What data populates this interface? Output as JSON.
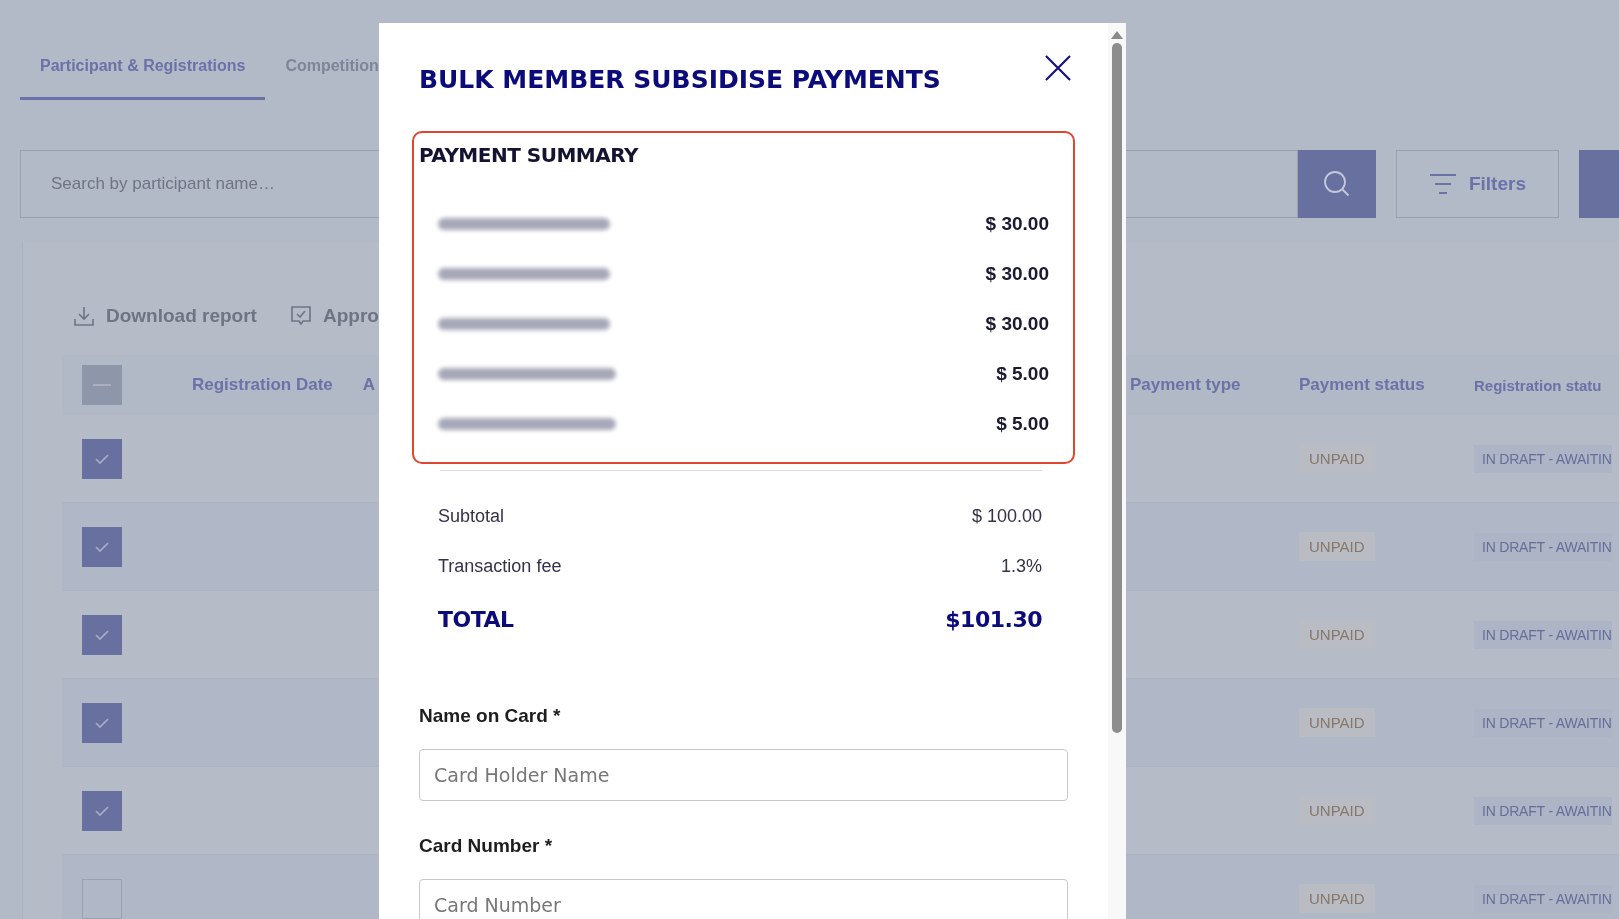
{
  "tabs": [
    {
      "label": "Participant & Registrations",
      "selected": true
    },
    {
      "label": "Competition",
      "selected": false
    }
  ],
  "search": {
    "placeholder": "Search by participant name…"
  },
  "filters_button": "Filters",
  "toolbar": [
    {
      "kind": "download",
      "label": "Download report"
    },
    {
      "kind": "approve",
      "label": "Appro"
    }
  ],
  "table": {
    "header_checkbox": {
      "indeterminate": true
    },
    "columns_left": [
      "Registration Date",
      "A"
    ],
    "columns_right": [
      "Payment type",
      "Payment status",
      "Registration statu"
    ],
    "rows": [
      {
        "checked": true,
        "payment_status": "UNPAID",
        "registration_status": "IN DRAFT - AWAITIN"
      },
      {
        "checked": true,
        "payment_status": "UNPAID",
        "registration_status": "IN DRAFT - AWAITIN"
      },
      {
        "checked": true,
        "payment_status": "UNPAID",
        "registration_status": "IN DRAFT - AWAITIN"
      },
      {
        "checked": true,
        "payment_status": "UNPAID",
        "registration_status": "IN DRAFT - AWAITIN"
      },
      {
        "checked": true,
        "payment_status": "UNPAID",
        "registration_status": "IN DRAFT - AWAITIN"
      },
      {
        "checked": false,
        "payment_status": "UNPAID",
        "registration_status": "IN DRAFT - AWAITIN"
      }
    ]
  },
  "modal": {
    "title": "BULK MEMBER SUBSIDISE PAYMENTS",
    "summary": {
      "heading": "PAYMENT SUMMARY",
      "items": [
        {
          "amount": "$ 30.00"
        },
        {
          "amount": "$ 30.00"
        },
        {
          "amount": "$ 30.00"
        },
        {
          "amount": "$ 5.00"
        },
        {
          "amount": "$ 5.00"
        }
      ],
      "subtotal_label": "Subtotal",
      "subtotal": "$ 100.00",
      "fee_label": "Transaction fee",
      "fee": "1.3%",
      "total_label": "TOTAL",
      "total": "$101.30"
    },
    "fields": [
      {
        "label": "Name on Card *",
        "placeholder": "Card Holder Name"
      },
      {
        "label": "Card Number *",
        "placeholder": "Card Number"
      }
    ]
  }
}
